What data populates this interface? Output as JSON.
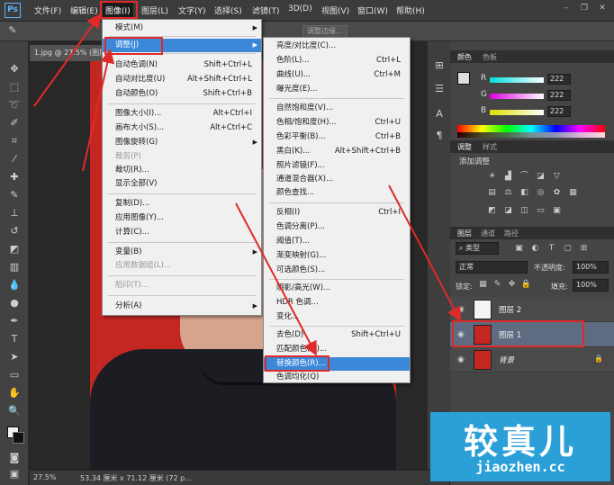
{
  "app": {
    "logo": "Ps"
  },
  "menubar": [
    {
      "label": "文件(F)"
    },
    {
      "label": "编辑(E)"
    },
    {
      "label": "图像(I)"
    },
    {
      "label": "图层(L)"
    },
    {
      "label": "文字(Y)"
    },
    {
      "label": "选择(S)"
    },
    {
      "label": "滤镜(T)"
    },
    {
      "label": "3D(D)"
    },
    {
      "label": "视图(V)"
    },
    {
      "label": "窗口(W)"
    },
    {
      "label": "帮助(H)"
    }
  ],
  "optbar": {
    "btn": "调整边缘..."
  },
  "document": {
    "tab": "1.jpg @ 27.5% (图层 1",
    "zoom": "27.5%",
    "size": "53.34 厘米 x 71.12 厘米 (72 p..."
  },
  "image_menu": [
    {
      "label": "模式(M)",
      "submenu": true
    },
    {
      "label": "调整(J)",
      "submenu": true,
      "highlight": true
    },
    {
      "label": "自动色调(N)",
      "shortcut": "Shift+Ctrl+L"
    },
    {
      "label": "自动对比度(U)",
      "shortcut": "Alt+Shift+Ctrl+L"
    },
    {
      "label": "自动颜色(O)",
      "shortcut": "Shift+Ctrl+B"
    },
    {
      "label": "图像大小(I)...",
      "shortcut": "Alt+Ctrl+I"
    },
    {
      "label": "画布大小(S)...",
      "shortcut": "Alt+Ctrl+C"
    },
    {
      "label": "图像旋转(G)",
      "submenu": true
    },
    {
      "label": "裁剪(P)",
      "disabled": true
    },
    {
      "label": "裁切(R)..."
    },
    {
      "label": "显示全部(V)",
      "disabled": true
    },
    {
      "label": "复制(D)..."
    },
    {
      "label": "应用图像(Y)..."
    },
    {
      "label": "计算(C)..."
    },
    {
      "label": "变量(B)",
      "submenu": true
    },
    {
      "label": "应用数据组(L)...",
      "disabled": true
    },
    {
      "label": "陷印(T)...",
      "disabled": true
    },
    {
      "label": "分析(A)",
      "submenu": true
    }
  ],
  "adjust_menu": [
    {
      "label": "亮度/对比度(C)..."
    },
    {
      "label": "色阶(L)...",
      "shortcut": "Ctrl+L"
    },
    {
      "label": "曲线(U)...",
      "shortcut": "Ctrl+M"
    },
    {
      "label": "曝光度(E)..."
    },
    {
      "label": "自然饱和度(V)..."
    },
    {
      "label": "色相/饱和度(H)...",
      "shortcut": "Ctrl+U"
    },
    {
      "label": "色彩平衡(B)...",
      "shortcut": "Ctrl+B"
    },
    {
      "label": "黑白(K)...",
      "shortcut": "Alt+Shift+Ctrl+B"
    },
    {
      "label": "照片滤镜(F)..."
    },
    {
      "label": "通道混合器(X)..."
    },
    {
      "label": "颜色查找..."
    },
    {
      "label": "反相(I)",
      "shortcut": "Ctrl+I"
    },
    {
      "label": "色调分离(P)..."
    },
    {
      "label": "阈值(T)..."
    },
    {
      "label": "渐变映射(G)..."
    },
    {
      "label": "可选颜色(S)..."
    },
    {
      "label": "阴影/高光(W)..."
    },
    {
      "label": "HDR 色调..."
    },
    {
      "label": "变化..."
    },
    {
      "label": "去色(D)",
      "shortcut": "Shift+Ctrl+U"
    },
    {
      "label": "匹配颜色(M)..."
    },
    {
      "label": "替换颜色(R)...",
      "highlight": true
    },
    {
      "label": "色调均化(Q)"
    }
  ],
  "color_panel": {
    "tabs": [
      "颜色",
      "色板"
    ],
    "channels": [
      {
        "name": "R",
        "value": "222"
      },
      {
        "name": "G",
        "value": "222"
      },
      {
        "name": "B",
        "value": "222"
      }
    ]
  },
  "adjust_panel": {
    "tabs": [
      "调整",
      "样式"
    ],
    "title": "添加调整"
  },
  "layers_panel": {
    "tabs": [
      "图层",
      "通道",
      "路径"
    ],
    "kind": "类型",
    "blend": "正常",
    "opacity_label": "不透明度:",
    "opacity": "100%",
    "lock_label": "锁定:",
    "fill_label": "填充:",
    "fill": "100%",
    "layers": [
      {
        "name": "图层 2"
      },
      {
        "name": "图层 1"
      },
      {
        "name": "背景"
      }
    ]
  },
  "watermark": {
    "cn": "较真儿",
    "en": "jiaozhen.cc"
  }
}
